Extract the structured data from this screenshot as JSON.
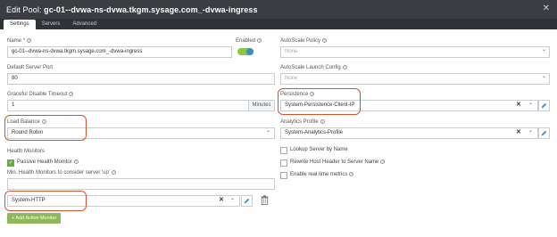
{
  "window": {
    "title_prefix": "Edit Pool: ",
    "title_name": "gc-01--dvwa-ns-dvwa.tkgm.sysage.com_-dvwa-ingress",
    "close_glyph": "✕"
  },
  "tabs": [
    {
      "label": "Settings",
      "active": true
    },
    {
      "label": "Servers",
      "active": false
    },
    {
      "label": "Advanced",
      "active": false
    }
  ],
  "form": {
    "name_label": "Name",
    "name_required": "*",
    "name_value": "gc-01--dvwa-ns-dvwa.tkgm.sysage.com_-dvwa-ingress",
    "enabled_label": "Enabled",
    "enabled": true,
    "default_port_label": "Default Server Port",
    "default_port_value": "80",
    "graceful_label": "Graceful Disable Timeout",
    "graceful_value": "1",
    "graceful_unit": "Minutes",
    "lb_label": "Load Balance",
    "lb_value": "Round Robin",
    "health_monitors_label": "Health Monitors",
    "passive_label": "Passive Health Monitor",
    "passive_checked": true,
    "min_health_label": "Min. Health Monitors to consider server 'up'",
    "min_health_value": "",
    "monitor_value": "System-HTTP",
    "add_monitor_label": "+ Add Active Monitor",
    "autoscale_policy_label": "AutoScale Policy",
    "autoscale_policy_placeholder": "None",
    "autoscale_launch_label": "AutoScale Launch Config",
    "autoscale_launch_placeholder": "None",
    "persistence_label": "Persistence",
    "persistence_value": "System-Persistence-Client-IP",
    "analytics_label": "Analytics Profile",
    "analytics_value": "System-Analytics-Profile",
    "lookup_label": "Lookup Server by Name",
    "rewrite_label": "Rewrite Host Header to Server Name",
    "realtime_label": "Enable real time metrics"
  },
  "glyphs": {
    "help": "?",
    "caret": "⌄",
    "clear": "✕",
    "check": "✓"
  },
  "colors": {
    "titlebar": "#3a3d42",
    "highlight": "#d4532f",
    "toggle_on": "#8dc63f",
    "add_button": "#8fb85a",
    "pencil": "#3a8fc9"
  }
}
